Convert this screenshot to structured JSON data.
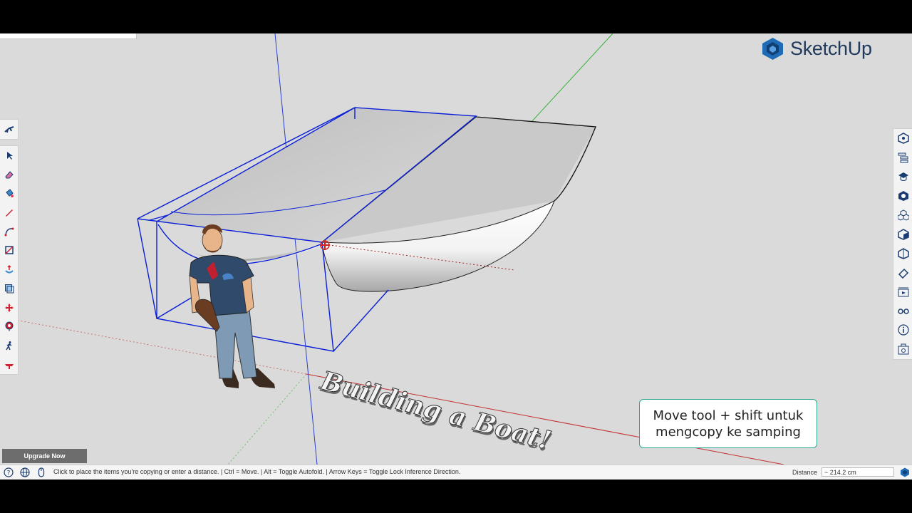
{
  "app": {
    "brand_name": "SketchUp",
    "brand_color": "#1f3a5c"
  },
  "viewport": {
    "title_text": "Building a Boat!",
    "caption_text": "Move tool + shift untuk\nmengcopy ke samping",
    "upgrade_label": "Upgrade Now"
  },
  "left_toolbar": {
    "top": [
      "walk-glyph-icon"
    ],
    "tools": [
      "select-arrow-icon",
      "eraser-icon",
      "paint-bucket-icon",
      "pencil-line-icon",
      "arc-icon",
      "rectangle-icon",
      "push-pull-icon",
      "offset-icon",
      "move-icon",
      "tape-measure-icon",
      "walk-person-icon",
      "section-plane-icon"
    ]
  },
  "right_toolbar": {
    "panels": [
      "entity-info-icon",
      "outliner-icon",
      "instructor-icon",
      "materials-icon",
      "components-icon",
      "styles-icon",
      "tags-icon",
      "soften-edges-icon",
      "scenes-icon",
      "display-icon",
      "info-icon",
      "export-icon"
    ]
  },
  "statusbar": {
    "message": "Click to place the items you're copying or enter a distance. | Ctrl = Move. | Alt = Toggle Autofold. | Arrow Keys = Toggle Lock Inference Direction.",
    "measurement_label": "Distance",
    "measurement_value": "~ 214.2 cm"
  },
  "colors": {
    "selection": "#0a1fd6",
    "caption_border": "#2aa58f",
    "axis_red": "#c43030",
    "axis_green": "#34b234",
    "axis_blue": "#2a40d0"
  }
}
